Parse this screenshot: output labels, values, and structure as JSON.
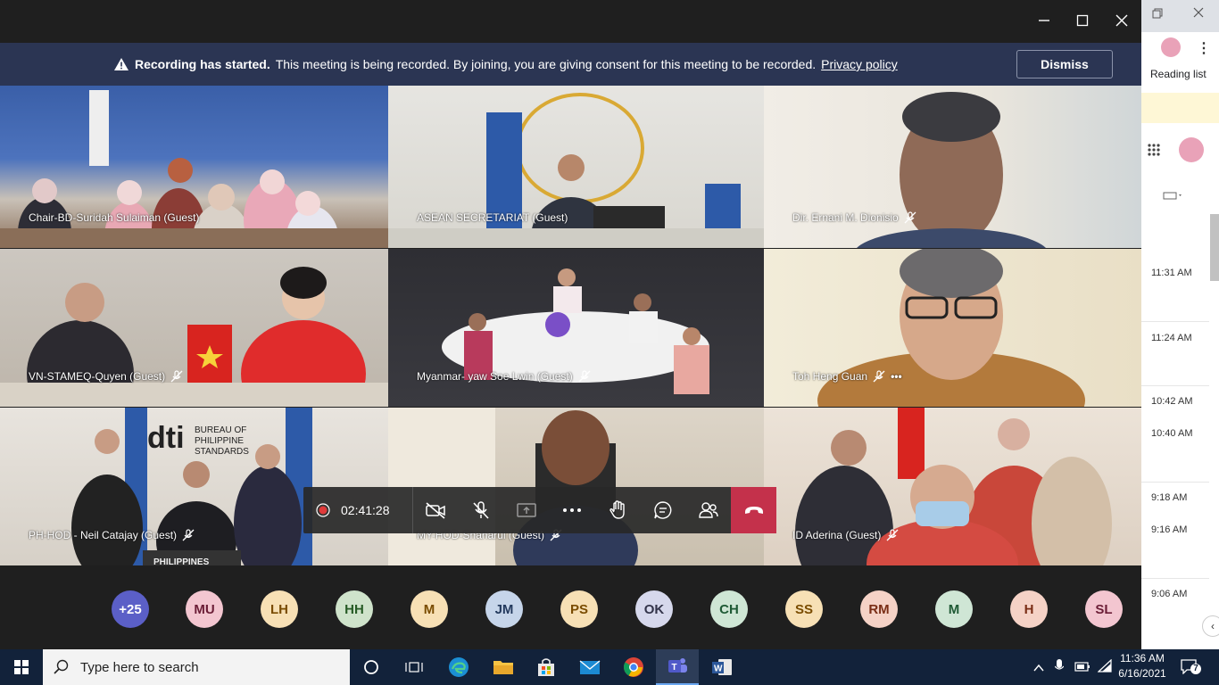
{
  "banner": {
    "bold": "Recording has started.",
    "text": "This meeting is being recorded. By joining, you are giving consent for this meeting to be recorded.",
    "link": "Privacy policy",
    "dismiss": "Dismiss"
  },
  "tiles": [
    {
      "name": "Chair-BD-Suridah Sulaiman (Guest)",
      "muted": false
    },
    {
      "name": "ASEAN SECRETARIAT (Guest)",
      "muted": false
    },
    {
      "name": "Dir. Ernani M. Dionisio",
      "muted": true
    },
    {
      "name": "VN-STAMEQ-Quyen (Guest)",
      "muted": true
    },
    {
      "name": "Myanmar- yaw Soe Lwin (Guest)",
      "muted": true
    },
    {
      "name": "Toh Heng Guan",
      "muted": true
    },
    {
      "name": "PH-HOD - Neil Catajay (Guest)",
      "muted": true
    },
    {
      "name": "MY-HOD-Shaharul (Guest)",
      "muted": true
    },
    {
      "name": "ID Aderina (Guest)",
      "muted": true
    }
  ],
  "controls": {
    "timer": "02:41:28",
    "buttons": [
      "camera-off",
      "mic-off",
      "share",
      "more",
      "raise-hand",
      "chat",
      "participants",
      "hang-up"
    ]
  },
  "participants": [
    {
      "initials": "+25",
      "bg": "#5b5fc7",
      "fg": "#ffffff"
    },
    {
      "initials": "MU",
      "bg": "#f3c6d0",
      "fg": "#6b1d36"
    },
    {
      "initials": "LH",
      "bg": "#f7e0b5",
      "fg": "#7a4c00"
    },
    {
      "initials": "HH",
      "bg": "#cfe3cb",
      "fg": "#275c26"
    },
    {
      "initials": "M",
      "bg": "#f7e0b5",
      "fg": "#7a4c00"
    },
    {
      "initials": "JM",
      "bg": "#c6d5ea",
      "fg": "#243a5e"
    },
    {
      "initials": "PS",
      "bg": "#f7e0b5",
      "fg": "#7a4c00"
    },
    {
      "initials": "OK",
      "bg": "#d6d8ec",
      "fg": "#33344a"
    },
    {
      "initials": "CH",
      "bg": "#cfe6d5",
      "fg": "#1f5a35"
    },
    {
      "initials": "SS",
      "bg": "#f7e0b5",
      "fg": "#7a4c00"
    },
    {
      "initials": "RM",
      "bg": "#f5d2c6",
      "fg": "#7a2e16"
    },
    {
      "initials": "M",
      "bg": "#cfe6d5",
      "fg": "#1f5a35"
    },
    {
      "initials": "H",
      "bg": "#f5d2c6",
      "fg": "#7a2e16"
    },
    {
      "initials": "SL",
      "bg": "#f3c6d0",
      "fg": "#6b1d36"
    }
  ],
  "browser": {
    "reading_list": "Reading list",
    "times": [
      "11:31 AM",
      "11:24 AM",
      "10:42 AM",
      "10:40 AM",
      "9:18 AM",
      "9:16 AM",
      "9:06 AM"
    ]
  },
  "taskbar": {
    "search_placeholder": "Type here to search",
    "time": "11:36 AM",
    "date": "6/16/2021",
    "notifications": "7"
  }
}
